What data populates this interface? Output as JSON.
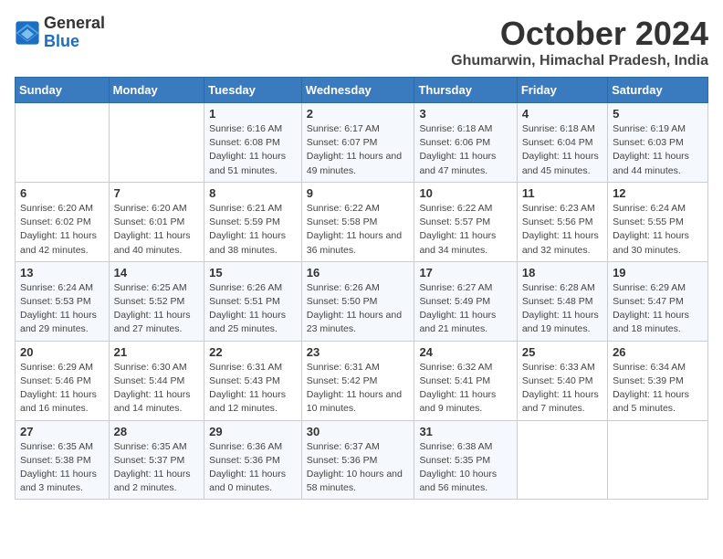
{
  "header": {
    "logo_general": "General",
    "logo_blue": "Blue",
    "month": "October 2024",
    "location": "Ghumarwin, Himachal Pradesh, India"
  },
  "weekdays": [
    "Sunday",
    "Monday",
    "Tuesday",
    "Wednesday",
    "Thursday",
    "Friday",
    "Saturday"
  ],
  "weeks": [
    [
      {
        "day": "",
        "info": ""
      },
      {
        "day": "",
        "info": ""
      },
      {
        "day": "1",
        "info": "Sunrise: 6:16 AM\nSunset: 6:08 PM\nDaylight: 11 hours and 51 minutes."
      },
      {
        "day": "2",
        "info": "Sunrise: 6:17 AM\nSunset: 6:07 PM\nDaylight: 11 hours and 49 minutes."
      },
      {
        "day": "3",
        "info": "Sunrise: 6:18 AM\nSunset: 6:06 PM\nDaylight: 11 hours and 47 minutes."
      },
      {
        "day": "4",
        "info": "Sunrise: 6:18 AM\nSunset: 6:04 PM\nDaylight: 11 hours and 45 minutes."
      },
      {
        "day": "5",
        "info": "Sunrise: 6:19 AM\nSunset: 6:03 PM\nDaylight: 11 hours and 44 minutes."
      }
    ],
    [
      {
        "day": "6",
        "info": "Sunrise: 6:20 AM\nSunset: 6:02 PM\nDaylight: 11 hours and 42 minutes."
      },
      {
        "day": "7",
        "info": "Sunrise: 6:20 AM\nSunset: 6:01 PM\nDaylight: 11 hours and 40 minutes."
      },
      {
        "day": "8",
        "info": "Sunrise: 6:21 AM\nSunset: 5:59 PM\nDaylight: 11 hours and 38 minutes."
      },
      {
        "day": "9",
        "info": "Sunrise: 6:22 AM\nSunset: 5:58 PM\nDaylight: 11 hours and 36 minutes."
      },
      {
        "day": "10",
        "info": "Sunrise: 6:22 AM\nSunset: 5:57 PM\nDaylight: 11 hours and 34 minutes."
      },
      {
        "day": "11",
        "info": "Sunrise: 6:23 AM\nSunset: 5:56 PM\nDaylight: 11 hours and 32 minutes."
      },
      {
        "day": "12",
        "info": "Sunrise: 6:24 AM\nSunset: 5:55 PM\nDaylight: 11 hours and 30 minutes."
      }
    ],
    [
      {
        "day": "13",
        "info": "Sunrise: 6:24 AM\nSunset: 5:53 PM\nDaylight: 11 hours and 29 minutes."
      },
      {
        "day": "14",
        "info": "Sunrise: 6:25 AM\nSunset: 5:52 PM\nDaylight: 11 hours and 27 minutes."
      },
      {
        "day": "15",
        "info": "Sunrise: 6:26 AM\nSunset: 5:51 PM\nDaylight: 11 hours and 25 minutes."
      },
      {
        "day": "16",
        "info": "Sunrise: 6:26 AM\nSunset: 5:50 PM\nDaylight: 11 hours and 23 minutes."
      },
      {
        "day": "17",
        "info": "Sunrise: 6:27 AM\nSunset: 5:49 PM\nDaylight: 11 hours and 21 minutes."
      },
      {
        "day": "18",
        "info": "Sunrise: 6:28 AM\nSunset: 5:48 PM\nDaylight: 11 hours and 19 minutes."
      },
      {
        "day": "19",
        "info": "Sunrise: 6:29 AM\nSunset: 5:47 PM\nDaylight: 11 hours and 18 minutes."
      }
    ],
    [
      {
        "day": "20",
        "info": "Sunrise: 6:29 AM\nSunset: 5:46 PM\nDaylight: 11 hours and 16 minutes."
      },
      {
        "day": "21",
        "info": "Sunrise: 6:30 AM\nSunset: 5:44 PM\nDaylight: 11 hours and 14 minutes."
      },
      {
        "day": "22",
        "info": "Sunrise: 6:31 AM\nSunset: 5:43 PM\nDaylight: 11 hours and 12 minutes."
      },
      {
        "day": "23",
        "info": "Sunrise: 6:31 AM\nSunset: 5:42 PM\nDaylight: 11 hours and 10 minutes."
      },
      {
        "day": "24",
        "info": "Sunrise: 6:32 AM\nSunset: 5:41 PM\nDaylight: 11 hours and 9 minutes."
      },
      {
        "day": "25",
        "info": "Sunrise: 6:33 AM\nSunset: 5:40 PM\nDaylight: 11 hours and 7 minutes."
      },
      {
        "day": "26",
        "info": "Sunrise: 6:34 AM\nSunset: 5:39 PM\nDaylight: 11 hours and 5 minutes."
      }
    ],
    [
      {
        "day": "27",
        "info": "Sunrise: 6:35 AM\nSunset: 5:38 PM\nDaylight: 11 hours and 3 minutes."
      },
      {
        "day": "28",
        "info": "Sunrise: 6:35 AM\nSunset: 5:37 PM\nDaylight: 11 hours and 2 minutes."
      },
      {
        "day": "29",
        "info": "Sunrise: 6:36 AM\nSunset: 5:36 PM\nDaylight: 11 hours and 0 minutes."
      },
      {
        "day": "30",
        "info": "Sunrise: 6:37 AM\nSunset: 5:36 PM\nDaylight: 10 hours and 58 minutes."
      },
      {
        "day": "31",
        "info": "Sunrise: 6:38 AM\nSunset: 5:35 PM\nDaylight: 10 hours and 56 minutes."
      },
      {
        "day": "",
        "info": ""
      },
      {
        "day": "",
        "info": ""
      }
    ]
  ]
}
